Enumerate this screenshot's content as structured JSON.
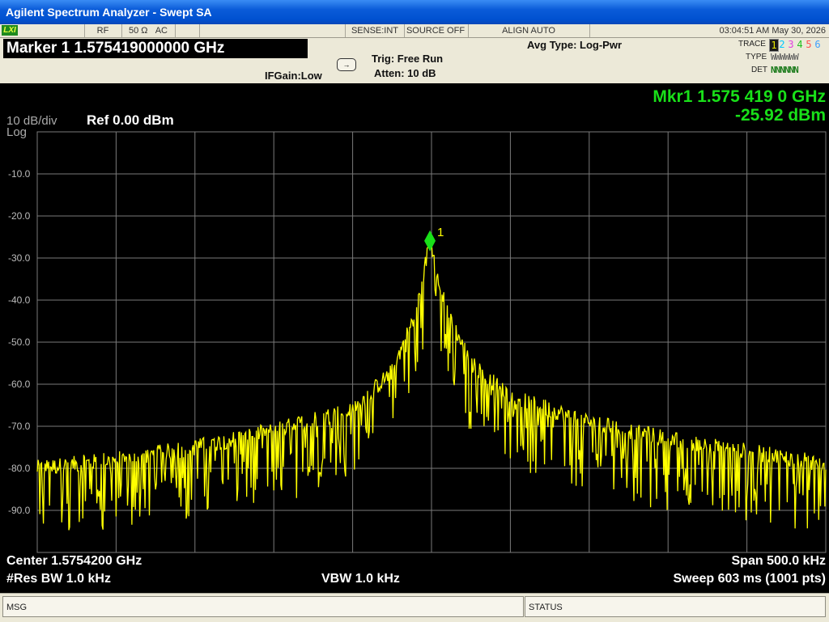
{
  "window": {
    "title": "Agilent Spectrum Analyzer - Swept SA"
  },
  "status": {
    "lxi": "LXI",
    "rf": "RF",
    "impedance": "50 Ω",
    "coupling": "AC",
    "sense": "SENSE:INT",
    "source": "SOURCE OFF",
    "align": "ALIGN AUTO",
    "datetime": "03:04:51 AM May 30, 2026"
  },
  "header": {
    "marker_title": "Marker 1 1.575419000000 GHz",
    "ifgain": "IFGain:Low",
    "trig": "Trig: Free Run",
    "atten": "Atten: 10 dB",
    "avg_type": "Avg Type: Log-Pwr",
    "trace_label": "TRACE",
    "type_label": "TYPE",
    "det_label": "DET",
    "trace_numbers": [
      "1",
      "2",
      "3",
      "4",
      "5",
      "6"
    ],
    "trace_colors": [
      "#e8e800",
      "#00c8ff",
      "#e040e0",
      "#20c020",
      "#ff5050",
      "#40a0ff"
    ],
    "type_values": "WWWWWW",
    "det_values": "NNNNNN"
  },
  "display": {
    "mkr_freq": "Mkr1 1.575 419 0 GHz",
    "mkr_amp": "-25.92 dBm",
    "scale_div": "10 dB/div",
    "scale_type": "Log",
    "ref_level": "Ref 0.00 dBm",
    "y_ticks": [
      "-10.0",
      "-20.0",
      "-30.0",
      "-40.0",
      "-50.0",
      "-60.0",
      "-70.0",
      "-80.0",
      "-90.0"
    ],
    "marker_label": "1",
    "center": "Center 1.5754200 GHz",
    "span": "Span 500.0 kHz",
    "rbw": "#Res BW 1.0 kHz",
    "vbw": "VBW 1.0 kHz",
    "sweep": "Sweep  603 ms (1001 pts)"
  },
  "bottom": {
    "msg": "MSG",
    "status": "STATUS"
  },
  "colors": {
    "trace": "#ffff00",
    "marker": "#19e019",
    "grid": "#7a7a7a",
    "readout": "#19e019"
  },
  "chart_data": {
    "type": "line",
    "title": "",
    "xlabel": "",
    "ylabel": "",
    "x_units": "GHz",
    "y_units": "dBm",
    "xlim": [
      1.57517,
      1.57567
    ],
    "ylim": [
      -100,
      0
    ],
    "grid": true,
    "series": [
      {
        "x": [
          1.57517,
          1.57522,
          1.57527,
          1.57532,
          1.57537,
          1.575395,
          1.57541,
          1.575419,
          1.57543,
          1.575445,
          1.57547,
          1.57552,
          1.57557,
          1.57562,
          1.57567
        ],
        "values": [
          -80,
          -78,
          -75,
          -71,
          -66,
          -57,
          -43,
          -25.92,
          -43,
          -55,
          -63,
          -69,
          -73,
          -76,
          -79
        ]
      }
    ],
    "marker": {
      "x": 1.575419,
      "y": -25.92
    }
  }
}
